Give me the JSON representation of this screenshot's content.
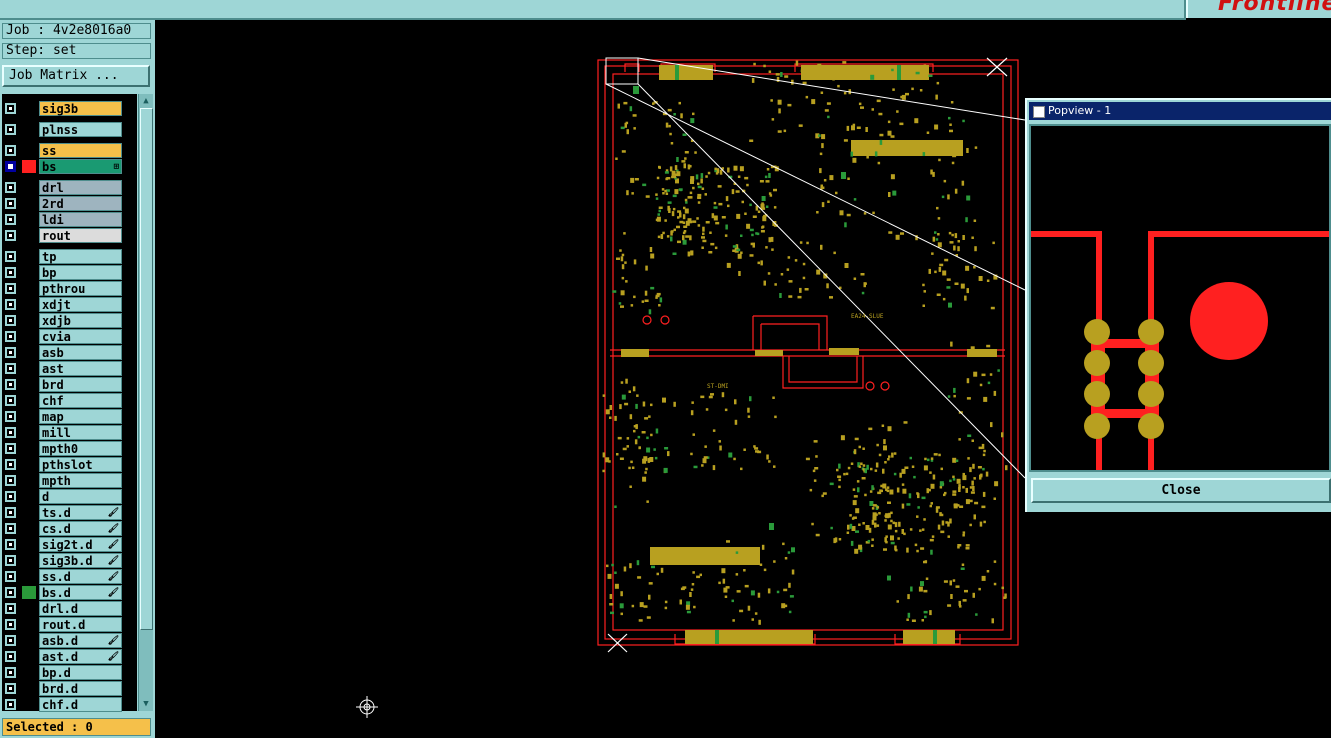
{
  "header": {
    "logo_text": "Frontline"
  },
  "job": {
    "label": "Job : 4v2e8016a0",
    "step": "Step: set"
  },
  "job_matrix_button": "Job Matrix ...",
  "layers": [
    {
      "name": "sig3b",
      "color": "#f5c04a",
      "active": false,
      "swatch": "",
      "mark": ""
    },
    {
      "name": "plnss",
      "color": "#9ed6d6",
      "active": false,
      "swatch": "",
      "mark": ""
    },
    {
      "name": "ss",
      "color": "#f5c04a",
      "active": false,
      "swatch": "",
      "mark": ""
    },
    {
      "name": "bs",
      "color": "#1a9a72",
      "active": true,
      "swatch": "#ff2020",
      "mark": "⊞"
    },
    {
      "name": "drl",
      "color": "#9eb4bf",
      "active": false,
      "swatch": "",
      "mark": ""
    },
    {
      "name": "2rd",
      "color": "#9eb4bf",
      "active": false,
      "swatch": "",
      "mark": ""
    },
    {
      "name": "ldi",
      "color": "#9eb4bf",
      "active": false,
      "swatch": "",
      "mark": ""
    },
    {
      "name": "rout",
      "color": "#dcdcdc",
      "active": false,
      "swatch": "",
      "mark": ""
    },
    {
      "name": "tp",
      "color": "#9ed6d6",
      "active": false,
      "swatch": "",
      "mark": ""
    },
    {
      "name": "bp",
      "color": "#9ed6d6",
      "active": false,
      "swatch": "",
      "mark": ""
    },
    {
      "name": "pthrou",
      "color": "#9ed6d6",
      "active": false,
      "swatch": "",
      "mark": ""
    },
    {
      "name": "xdjt",
      "color": "#9ed6d6",
      "active": false,
      "swatch": "",
      "mark": ""
    },
    {
      "name": "xdjb",
      "color": "#9ed6d6",
      "active": false,
      "swatch": "",
      "mark": ""
    },
    {
      "name": "cvia",
      "color": "#9ed6d6",
      "active": false,
      "swatch": "",
      "mark": ""
    },
    {
      "name": "asb",
      "color": "#9ed6d6",
      "active": false,
      "swatch": "",
      "mark": ""
    },
    {
      "name": "ast",
      "color": "#9ed6d6",
      "active": false,
      "swatch": "",
      "mark": ""
    },
    {
      "name": "brd",
      "color": "#9ed6d6",
      "active": false,
      "swatch": "",
      "mark": ""
    },
    {
      "name": "chf",
      "color": "#9ed6d6",
      "active": false,
      "swatch": "",
      "mark": ""
    },
    {
      "name": "map",
      "color": "#9ed6d6",
      "active": false,
      "swatch": "",
      "mark": ""
    },
    {
      "name": "mill",
      "color": "#9ed6d6",
      "active": false,
      "swatch": "",
      "mark": ""
    },
    {
      "name": "mpth0",
      "color": "#9ed6d6",
      "active": false,
      "swatch": "",
      "mark": ""
    },
    {
      "name": "pthslot",
      "color": "#9ed6d6",
      "active": false,
      "swatch": "",
      "mark": ""
    },
    {
      "name": "mpth",
      "color": "#9ed6d6",
      "active": false,
      "swatch": "",
      "mark": ""
    },
    {
      "name": "d",
      "color": "#9ed6d6",
      "active": false,
      "swatch": "",
      "mark": ""
    },
    {
      "name": "ts.d",
      "color": "#9ed6d6",
      "active": false,
      "swatch": "",
      "mark": "🖌"
    },
    {
      "name": "cs.d",
      "color": "#9ed6d6",
      "active": false,
      "swatch": "",
      "mark": "🖌"
    },
    {
      "name": "sig2t.d",
      "color": "#9ed6d6",
      "active": false,
      "swatch": "",
      "mark": "🖌"
    },
    {
      "name": "sig3b.d",
      "color": "#9ed6d6",
      "active": false,
      "swatch": "",
      "mark": "🖌"
    },
    {
      "name": "ss.d",
      "color": "#9ed6d6",
      "active": false,
      "swatch": "",
      "mark": "🖌"
    },
    {
      "name": "bs.d",
      "color": "#9ed6d6",
      "active": false,
      "swatch": "#2a9a3a",
      "mark": "🖌"
    },
    {
      "name": "drl.d",
      "color": "#9ed6d6",
      "active": false,
      "swatch": "",
      "mark": ""
    },
    {
      "name": "rout.d",
      "color": "#9ed6d6",
      "active": false,
      "swatch": "",
      "mark": ""
    },
    {
      "name": "asb.d",
      "color": "#9ed6d6",
      "active": false,
      "swatch": "",
      "mark": "🖌"
    },
    {
      "name": "ast.d",
      "color": "#9ed6d6",
      "active": false,
      "swatch": "",
      "mark": "🖌"
    },
    {
      "name": "bp.d",
      "color": "#9ed6d6",
      "active": false,
      "swatch": "",
      "mark": ""
    },
    {
      "name": "brd.d",
      "color": "#9ed6d6",
      "active": false,
      "swatch": "",
      "mark": ""
    },
    {
      "name": "chf.d",
      "color": "#9ed6d6",
      "active": false,
      "swatch": "",
      "mark": ""
    }
  ],
  "status": {
    "selected": "Selected : 0"
  },
  "board": {
    "labels": [
      "ST-DMI",
      "EA24-SLUE"
    ]
  },
  "popview": {
    "title": "Popview - 1",
    "close_label": "Close"
  },
  "colors": {
    "panel": "#9ed6d6",
    "outline": "#ff2020",
    "pad": "#b8a020",
    "green": "#2a9a3a",
    "title_bar": "#0a246a"
  }
}
